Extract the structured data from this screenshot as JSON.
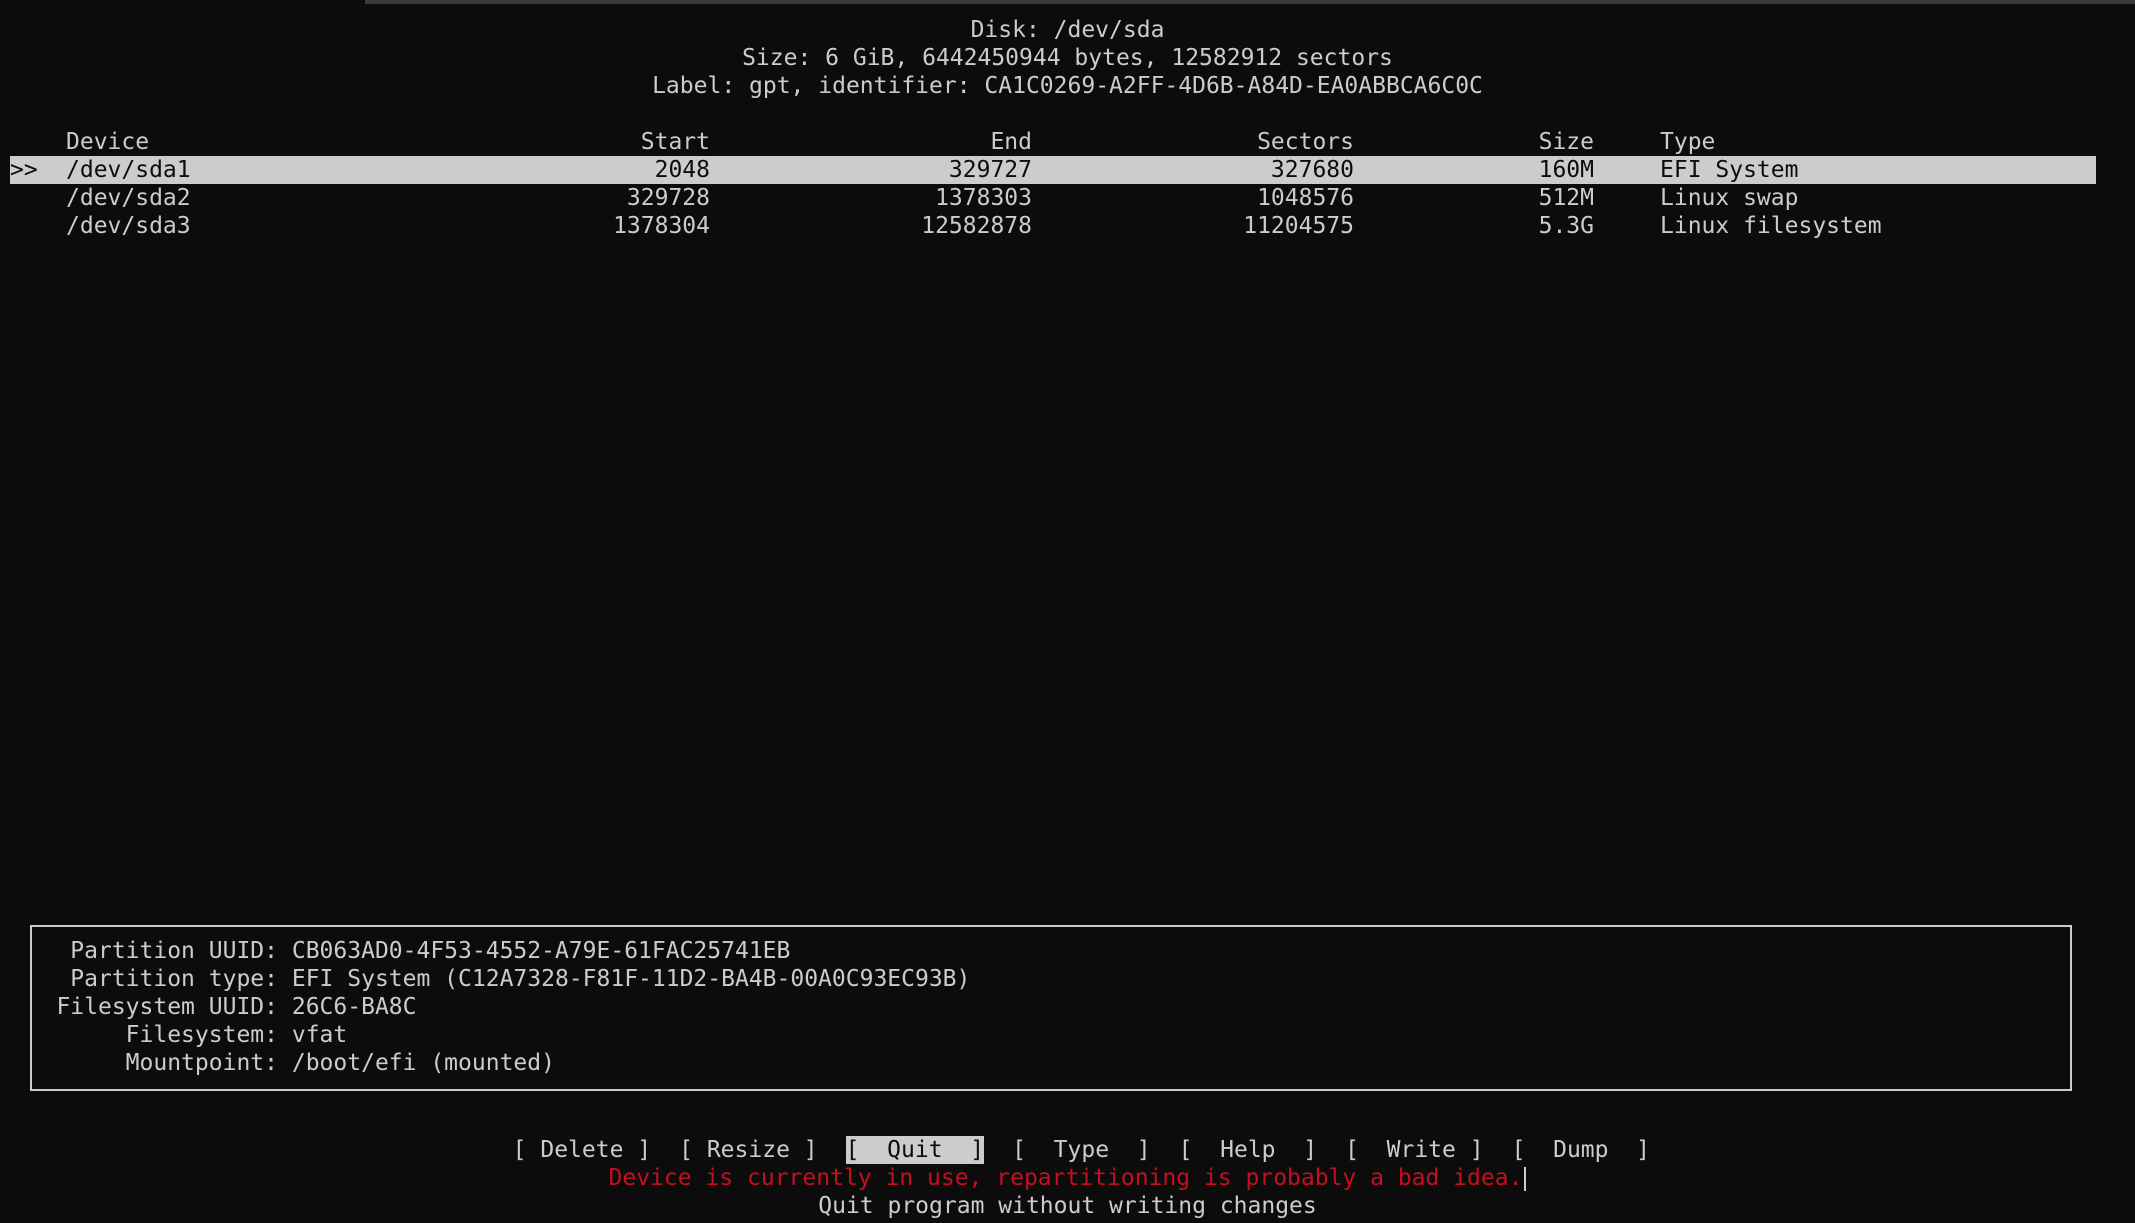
{
  "disk": {
    "title": "Disk: /dev/sda",
    "size_line": "Size: 6 GiB, 6442450944 bytes, 12582912 sectors",
    "label_line": "Label: gpt, identifier: CA1C0269-A2FF-4D6B-A84D-EA0ABBCA6C0C"
  },
  "table": {
    "headers": {
      "device": "Device",
      "start": "Start",
      "end": "End",
      "sectors": "Sectors",
      "size": "Size",
      "type": "Type"
    },
    "selected_marker": ">>",
    "rows": [
      {
        "device": "/dev/sda1",
        "start": "2048",
        "end": "329727",
        "sectors": "327680",
        "size": "160M",
        "type": "EFI System"
      },
      {
        "device": "/dev/sda2",
        "start": "329728",
        "end": "1378303",
        "sectors": "1048576",
        "size": "512M",
        "type": "Linux swap"
      },
      {
        "device": "/dev/sda3",
        "start": "1378304",
        "end": "12582878",
        "sectors": "11204575",
        "size": "5.3G",
        "type": "Linux filesystem"
      }
    ]
  },
  "details": [
    {
      "key": "Partition UUID:",
      "value": "CB063AD0-4F53-4552-A79E-61FAC25741EB"
    },
    {
      "key": "Partition type:",
      "value": "EFI System (C12A7328-F81F-11D2-BA4B-00A0C93EC93B)"
    },
    {
      "key": "Filesystem UUID:",
      "value": "26C6-BA8C"
    },
    {
      "key": "Filesystem:",
      "value": "vfat"
    },
    {
      "key": "Mountpoint:",
      "value": "/boot/efi (mounted)"
    }
  ],
  "menu": [
    {
      "label": "[ Delete ]"
    },
    {
      "label": "[ Resize ]"
    },
    {
      "label": "[  Quit  ]"
    },
    {
      "label": "[  Type  ]"
    },
    {
      "label": "[  Help  ]"
    },
    {
      "label": "[  Write ]"
    },
    {
      "label": "[  Dump  ]"
    }
  ],
  "status": {
    "warning": "Device is currently in use, repartitioning is probably a bad idea.",
    "hint": "Quit program without writing changes"
  },
  "colors": {
    "background": "#0c0c0c",
    "foreground": "#cccccc",
    "warning": "#c50f1f"
  }
}
